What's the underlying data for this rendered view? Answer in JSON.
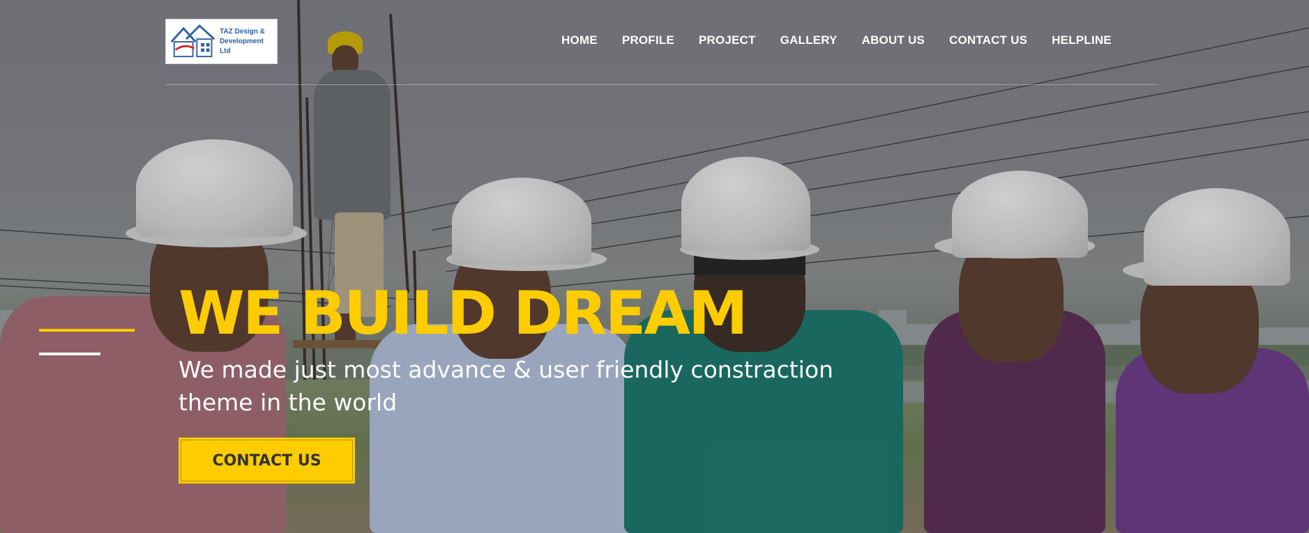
{
  "logo": {
    "line1": "TAZ Design &",
    "line2": "Development Ltd"
  },
  "nav": {
    "items": [
      "HOME",
      "PROFILE",
      "PROJECT",
      "GALLERY",
      "ABOUT US",
      "CONTACT US",
      "HELPLINE"
    ]
  },
  "hero": {
    "title": "WE BUILD DREAM",
    "subtitle": "We made just most advance & user friendly constraction theme in the world",
    "cta_label": "CONTACT US"
  },
  "colors": {
    "accent": "#ffcc00",
    "nav_text": "#ffffff",
    "cta_text": "#333333"
  }
}
